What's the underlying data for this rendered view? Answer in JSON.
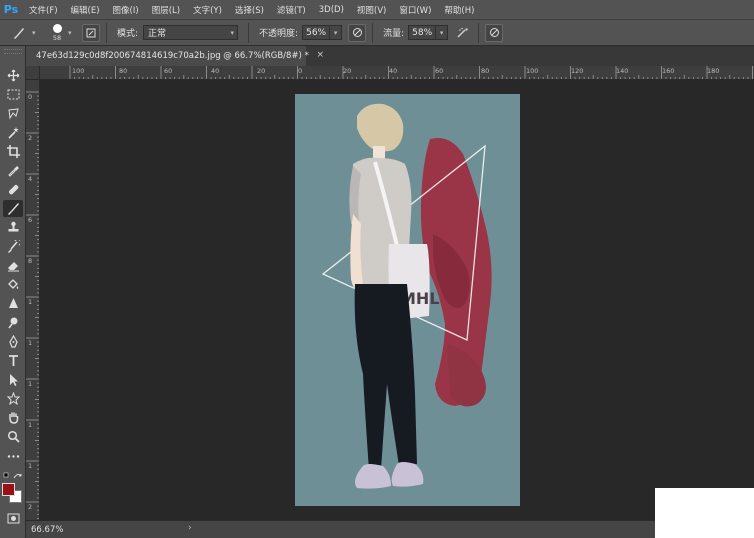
{
  "app": {
    "logo": "Ps"
  },
  "menu": {
    "items": [
      {
        "label": "文件(F)"
      },
      {
        "label": "编辑(E)"
      },
      {
        "label": "图像(I)"
      },
      {
        "label": "图层(L)"
      },
      {
        "label": "文字(Y)"
      },
      {
        "label": "选择(S)"
      },
      {
        "label": "滤镜(T)"
      },
      {
        "label": "3D(D)"
      },
      {
        "label": "视图(V)"
      },
      {
        "label": "窗口(W)"
      },
      {
        "label": "帮助(H)"
      }
    ]
  },
  "options": {
    "brush_size": "58",
    "mode_label": "模式:",
    "mode_value": "正常",
    "opacity_label": "不透明度:",
    "opacity_value": "56%",
    "flow_label": "流量:",
    "flow_value": "58%"
  },
  "document": {
    "tab_title": "47e63d129c0d8f200674814619c70a2b.jpg @ 66.7%(RGB/8#) *",
    "close_symbol": "×"
  },
  "ruler": {
    "top_labels": [
      "100",
      "80",
      "60",
      "40",
      "20",
      "0",
      "20",
      "40",
      "60",
      "80",
      "100",
      "120",
      "140",
      "160",
      "180"
    ],
    "left_labels": [
      "0",
      "2",
      "4",
      "6",
      "8",
      "1",
      "1",
      "1",
      "1",
      "1",
      "2",
      "2",
      "2"
    ]
  },
  "colors": {
    "foreground": "#9b1015",
    "background": "#ffffff",
    "canvas_bg": "#6f8f96"
  },
  "tools": [
    "move-icon",
    "marquee-icon",
    "lasso-icon",
    "magic-wand-icon",
    "crop-icon",
    "eyedropper-icon",
    "healing-brush-icon",
    "brush-icon",
    "clone-stamp-icon",
    "history-brush-icon",
    "eraser-icon",
    "paint-bucket-icon",
    "blur-icon",
    "dodge-icon",
    "pen-icon",
    "type-icon",
    "path-selection-icon",
    "shape-icon",
    "hand-icon",
    "zoom-icon",
    "more-tools-icon"
  ],
  "status": {
    "zoom": "66.67%",
    "arrow": "›"
  },
  "artwork": {
    "bag_text": "MHL"
  }
}
